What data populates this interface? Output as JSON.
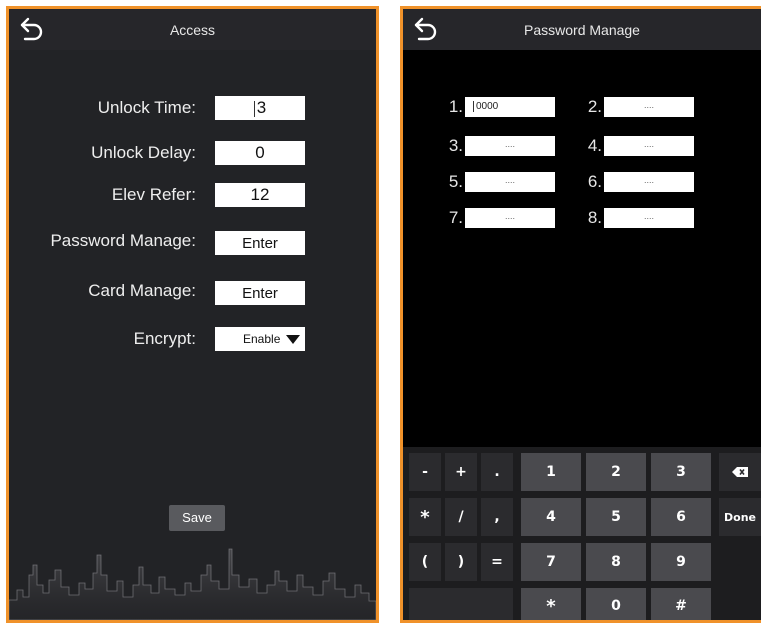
{
  "access": {
    "title": "Access",
    "fields": [
      {
        "label": "Unlock Time:",
        "value": "3"
      },
      {
        "label": "Unlock Delay:",
        "value": "0"
      },
      {
        "label": "Elev Refer:",
        "value": "12"
      },
      {
        "label": "Password Manage:",
        "value": "Enter"
      },
      {
        "label": "Card Manage:",
        "value": "Enter"
      },
      {
        "label": "Encrypt:",
        "value": "Enable"
      }
    ],
    "save_label": "Save"
  },
  "password": {
    "title": "Password Manage",
    "slots": [
      {
        "num": "1.",
        "value": "0000"
      },
      {
        "num": "2.",
        "value": "...."
      },
      {
        "num": "3.",
        "value": "...."
      },
      {
        "num": "4.",
        "value": "...."
      },
      {
        "num": "5.",
        "value": "...."
      },
      {
        "num": "6.",
        "value": "...."
      },
      {
        "num": "7.",
        "value": "...."
      },
      {
        "num": "8.",
        "value": "...."
      }
    ]
  },
  "keyboard": {
    "row1": [
      "-",
      "+",
      ".",
      "1",
      "2",
      "3"
    ],
    "row2": [
      "*",
      "/",
      ",",
      "4",
      "5",
      "6"
    ],
    "row3": [
      "(",
      ")",
      "=",
      "7",
      "8",
      "9"
    ],
    "row4": [
      "*",
      "0",
      "#"
    ],
    "done_label": "Done",
    "backspace_icon": "backspace-icon"
  },
  "colors": {
    "frame_border": "#f0922a",
    "left_bg": "#222326",
    "right_bg": "#000000"
  }
}
